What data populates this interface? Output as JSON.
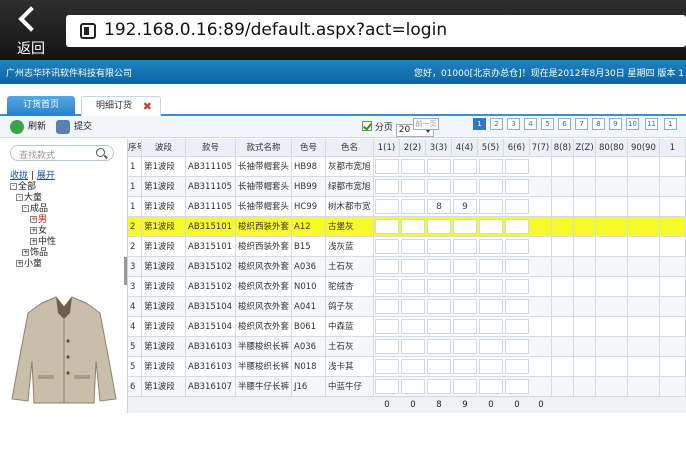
{
  "browser": {
    "back_label": "返回",
    "url": "192.168.0.16:89/default.aspx?act=login"
  },
  "header": {
    "company": "广州志华环讯软件科技有限公司",
    "welcome": "您好，01000[北京办总仓]！现在是2012年8月30日 星期四 版本 1"
  },
  "tabs": [
    {
      "label": "订货首页"
    },
    {
      "label": "明细订货",
      "close": "✖"
    }
  ],
  "toolbar": {
    "refresh_label": "刷新",
    "submit_label": "提交",
    "paging_label": "分页",
    "page_size": "20",
    "first_page": "前一页",
    "pages": [
      "1",
      "2",
      "3",
      "4",
      "5",
      "6",
      "7",
      "8",
      "9",
      "10",
      "11",
      "1"
    ]
  },
  "search": {
    "placeholder": "查找款式"
  },
  "tree": {
    "collapse": "收拢",
    "sep": "|",
    "expand": "展开",
    "nodes": [
      {
        "box": "-",
        "label": "全部"
      },
      {
        "box": "-",
        "label": "大童"
      },
      {
        "box": "-",
        "label": "成品"
      },
      {
        "box": "+",
        "label": "男"
      },
      {
        "box": "+",
        "label": "女"
      },
      {
        "box": "+",
        "label": "中性"
      },
      {
        "box": "+",
        "label": "饰品"
      },
      {
        "box": "+",
        "label": "小童"
      }
    ]
  },
  "grid": {
    "headers": [
      "序号",
      "波段",
      "款号",
      "款式名称",
      "色号",
      "色名",
      "1(1)",
      "2(2)",
      "3(3)",
      "4(4)",
      "5(5)",
      "6(6)",
      "7(7)",
      "8(8)",
      "Z(Z)",
      "80(80",
      "90(90",
      "1"
    ],
    "rows": [
      {
        "seq": "1",
        "wave": "第1波段",
        "style_no": "AB311105",
        "style_name": "长袖带帽套头",
        "color_no": "HB98",
        "color_name": "灰都市宽旭",
        "q3": "",
        "q4": "",
        "hl": false
      },
      {
        "seq": "1",
        "wave": "第1波段",
        "style_no": "AB311105",
        "style_name": "长袖带帽套头",
        "color_no": "HB99",
        "color_name": "绿都市宽旭",
        "q3": "",
        "q4": "",
        "hl": false
      },
      {
        "seq": "1",
        "wave": "第1波段",
        "style_no": "AB311105",
        "style_name": "长袖带帽套头",
        "color_no": "HC99",
        "color_name": "树木都市宽",
        "q3": "8",
        "q4": "9",
        "hl": false
      },
      {
        "seq": "2",
        "wave": "第1波段",
        "style_no": "AB315101",
        "style_name": "梭织西装外套",
        "color_no": "A12",
        "color_name": "古堡灰",
        "q3": "",
        "q4": "",
        "hl": true
      },
      {
        "seq": "2",
        "wave": "第1波段",
        "style_no": "AB315101",
        "style_name": "梭织西装外套",
        "color_no": "B15",
        "color_name": "浅灰蓝",
        "q3": "",
        "q4": "",
        "hl": false
      },
      {
        "seq": "3",
        "wave": "第1波段",
        "style_no": "AB315102",
        "style_name": "梭织风衣外套",
        "color_no": "A036",
        "color_name": "土石灰",
        "q3": "",
        "q4": "",
        "hl": false
      },
      {
        "seq": "3",
        "wave": "第1波段",
        "style_no": "AB315102",
        "style_name": "梭织风衣外套",
        "color_no": "N010",
        "color_name": "驼绒杏",
        "q3": "",
        "q4": "",
        "hl": false
      },
      {
        "seq": "4",
        "wave": "第1波段",
        "style_no": "AB315104",
        "style_name": "梭织风衣外套",
        "color_no": "A041",
        "color_name": "鸽子灰",
        "q3": "",
        "q4": "",
        "hl": false
      },
      {
        "seq": "4",
        "wave": "第1波段",
        "style_no": "AB315104",
        "style_name": "梭织风衣外套",
        "color_no": "B061",
        "color_name": "中森蓝",
        "q3": "",
        "q4": "",
        "hl": false
      },
      {
        "seq": "5",
        "wave": "第1波段",
        "style_no": "AB316103",
        "style_name": "半腰梭织长裤",
        "color_no": "A036",
        "color_name": "土石灰",
        "q3": "",
        "q4": "",
        "hl": false
      },
      {
        "seq": "5",
        "wave": "第1波段",
        "style_no": "AB316103",
        "style_name": "半腰梭织长裤",
        "color_no": "N018",
        "color_name": "浅卡其",
        "q3": "",
        "q4": "",
        "hl": false
      },
      {
        "seq": "6",
        "wave": "第1波段",
        "style_no": "AB316107",
        "style_name": "半腰牛仔长裤",
        "color_no": "J16",
        "color_name": "中蓝牛仔",
        "q3": "",
        "q4": "",
        "hl": false
      }
    ],
    "totals": [
      "0",
      "0",
      "8",
      "9",
      "0",
      "0",
      "0"
    ]
  },
  "colors": {
    "header_blue": "#1670b5",
    "highlight_row": "#f8f92a",
    "tab_blue": "#2b7fc6"
  }
}
